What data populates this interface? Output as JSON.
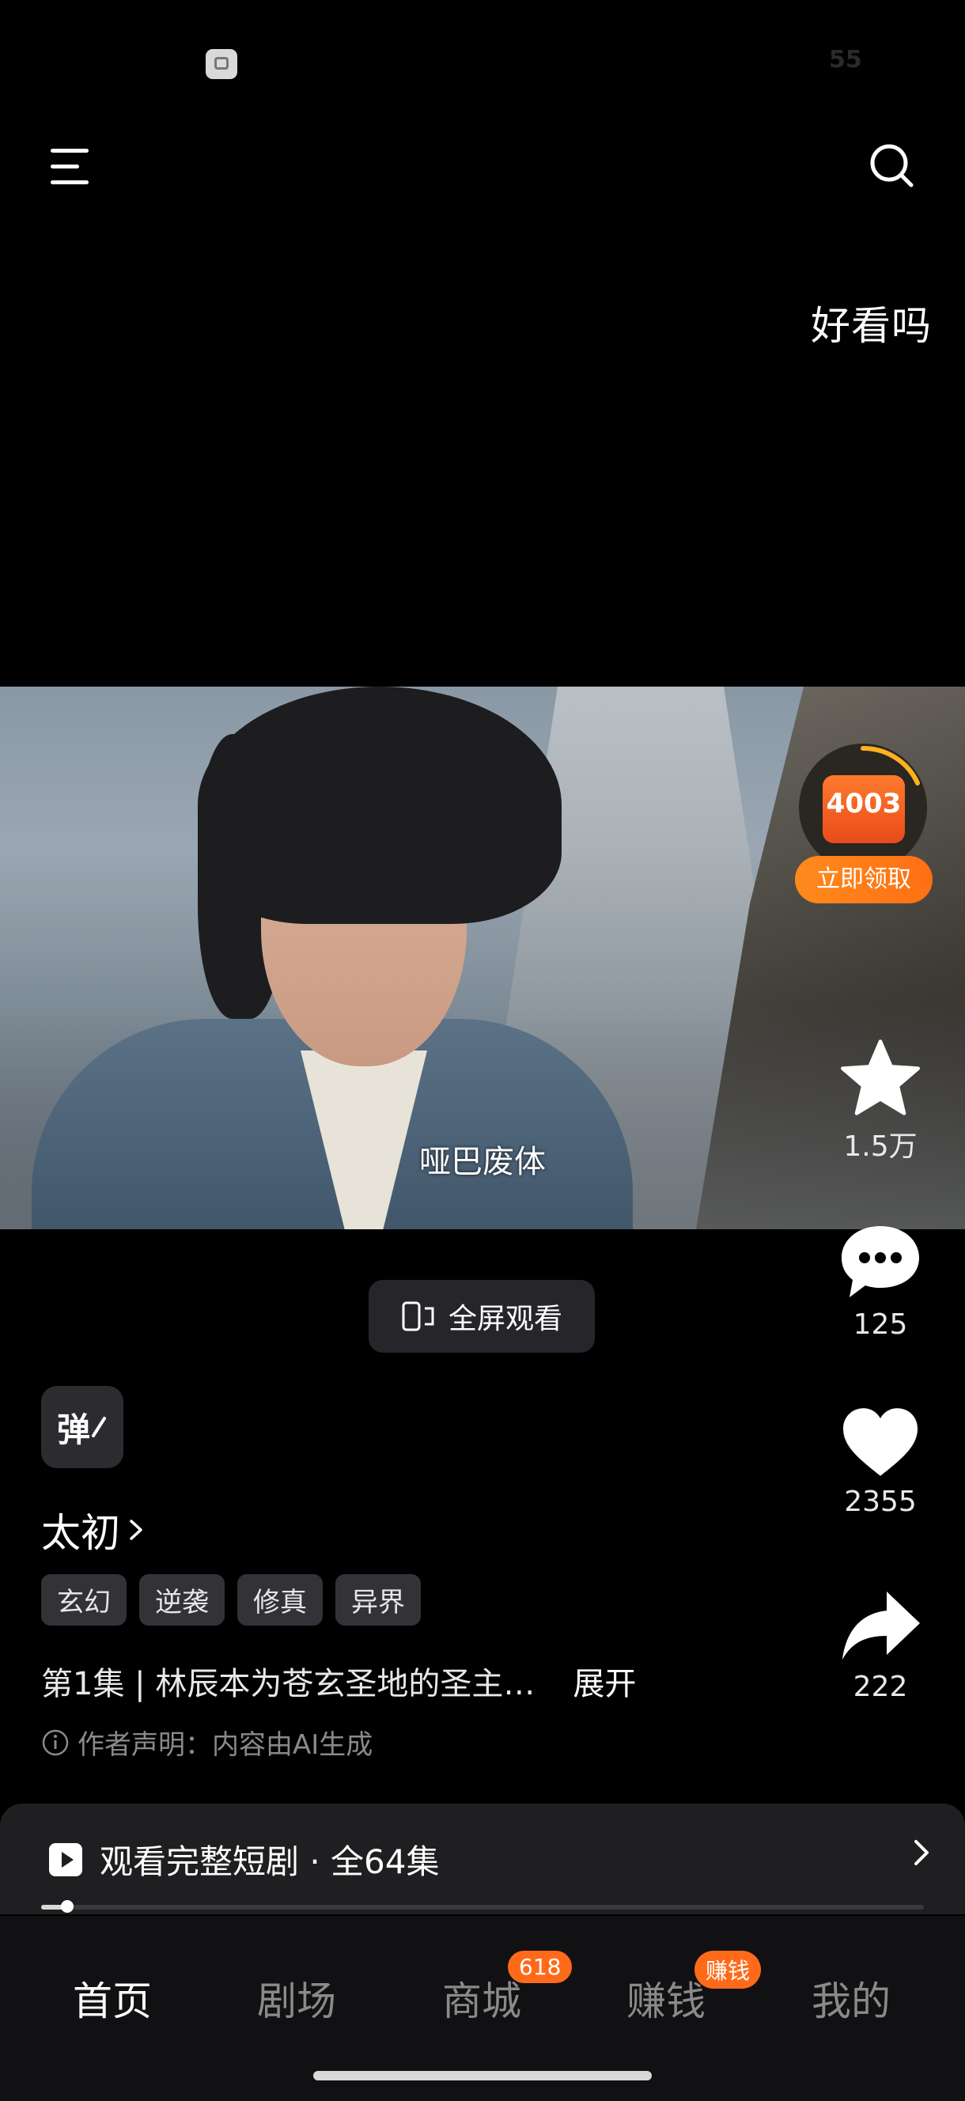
{
  "status_bar": {
    "right_number": "55"
  },
  "header": {
    "corner_text": "好看吗"
  },
  "video": {
    "caption": "哑巴废体"
  },
  "reward": {
    "count": "4003",
    "button_label": "立即领取"
  },
  "actions": {
    "favorite_count": "1.5万",
    "comment_count": "125",
    "like_count": "2355",
    "share_count": "222"
  },
  "fullscreen_button": {
    "label": "全屏观看"
  },
  "danmu_button": {
    "label": "弹"
  },
  "drama": {
    "title": "太初",
    "tags": [
      "玄幻",
      "逆袭",
      "修真",
      "异界"
    ],
    "description": "第1集 | 林辰本为苍玄圣地的圣主…",
    "expand_label": "展开",
    "notice": "作者声明：内容由AI生成"
  },
  "series_bar": {
    "label": "观看完整短剧 · 全64集",
    "progress": 0.03
  },
  "bottom_nav": {
    "items": [
      {
        "label": "首页"
      },
      {
        "label": "剧场"
      },
      {
        "label": "商城",
        "badge": "618"
      },
      {
        "label": "赚钱",
        "badge": "赚钱"
      },
      {
        "label": "我的"
      }
    ],
    "active_index": 0
  }
}
